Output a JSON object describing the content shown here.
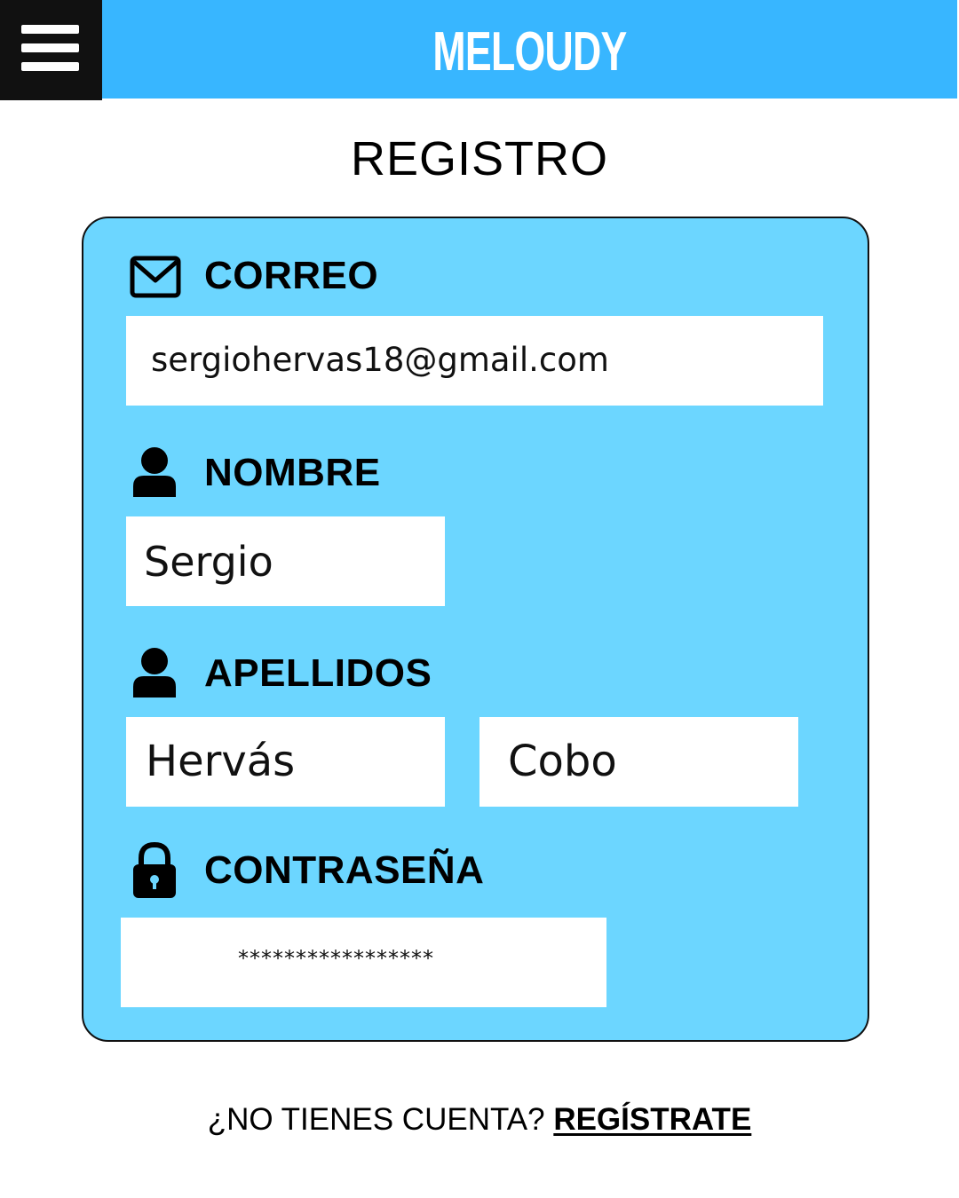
{
  "header": {
    "brand": "MELOUDY",
    "menu_icon": "hamburger-menu-icon",
    "menu_color": "#111111",
    "bar_color": "#38b6ff"
  },
  "page_title": "REGISTRO",
  "form": {
    "card_color": "#6cd6ff",
    "email": {
      "icon": "envelope-icon",
      "label": "CORREO",
      "value": "sergiohervas18@gmail.com"
    },
    "first_name": {
      "icon": "user-icon",
      "label": "NOMBRE",
      "value": "Sergio"
    },
    "surnames": {
      "icon": "user-icon",
      "label": "APELLIDOS",
      "first_value": "Hervás",
      "second_value": "Cobo"
    },
    "password": {
      "icon": "lock-icon",
      "label": "CONTRASEÑA",
      "value": "*****************"
    }
  },
  "footer": {
    "prompt": "¿NO TIENES CUENTA?",
    "link": "REGÍSTRATE"
  }
}
